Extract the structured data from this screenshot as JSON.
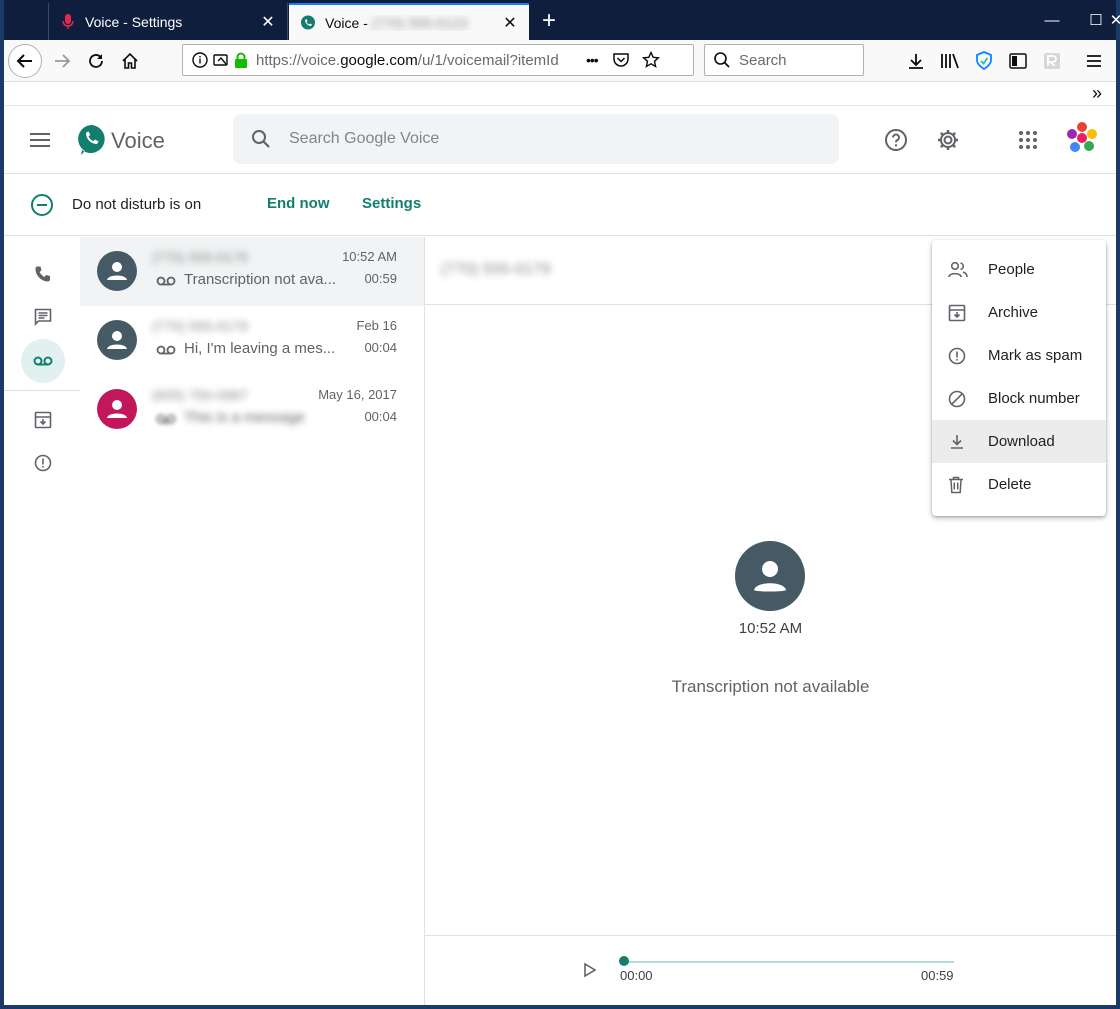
{
  "browser": {
    "tabs": [
      {
        "label": "Voice - Settings",
        "close": "✕"
      },
      {
        "label": "Voice - ",
        "label_hidden": "(770) 555-0123",
        "close": "✕"
      }
    ],
    "new_tab": "+",
    "window_controls": {
      "minimize": "—",
      "maximize": "☐",
      "close": "✕"
    },
    "url": {
      "host_prefix": "https://voice.",
      "host_domain": "google.com",
      "path": "/u/1/voicemail?itemId"
    },
    "url_more": "•••",
    "search_placeholder": "Search",
    "overflow": "»"
  },
  "app": {
    "title": "Voice",
    "search_placeholder": "Search Google Voice",
    "dnd": {
      "status": "Do not disturb is on",
      "end_now": "End now",
      "settings": "Settings"
    },
    "conversations": [
      {
        "name": "(770) 555-0179",
        "time": "10:52 AM",
        "duration": "00:59",
        "snippet": "Transcription not ava...",
        "avatar_color": "#455a64",
        "selected": true
      },
      {
        "name": "(770) 555-0179",
        "time": "Feb 16",
        "duration": "00:04",
        "snippet": "Hi, I'm leaving a mes...",
        "avatar_color": "#455a64",
        "selected": false
      },
      {
        "name": "(605) 750-0987",
        "time": "May 16, 2017",
        "duration": "00:04",
        "snippet": "This is a message",
        "avatar_color": "#c2185b",
        "selected": false
      }
    ],
    "detail": {
      "number": "(770) 555-0179",
      "time": "10:52 AM",
      "transcription": "Transcription not available",
      "player": {
        "start": "00:00",
        "end": "00:59",
        "progress": 0
      }
    },
    "menu": [
      {
        "label": "People",
        "icon": "people-icon"
      },
      {
        "label": "Archive",
        "icon": "archive-icon"
      },
      {
        "label": "Mark as spam",
        "icon": "spam-icon"
      },
      {
        "label": "Block number",
        "icon": "block-icon"
      },
      {
        "label": "Download",
        "icon": "download-icon",
        "hover": true
      },
      {
        "label": "Delete",
        "icon": "delete-icon"
      }
    ],
    "colors": {
      "accent": "#137e6e",
      "avatar_gray": "#455a64",
      "avatar_pink": "#c2185b"
    }
  }
}
